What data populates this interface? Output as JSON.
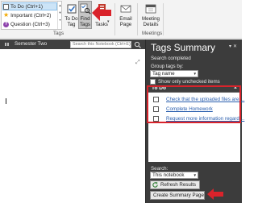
{
  "ribbon": {
    "tags": [
      {
        "label": "To Do (Ctrl+1)",
        "icon": "checkbox-icon"
      },
      {
        "label": "Important (Ctrl+2)",
        "icon": "star-icon"
      },
      {
        "label": "Question (Ctrl+3)",
        "icon": "question-icon"
      }
    ],
    "tags_group_label": "Tags",
    "todo_tag_line1": "To Do",
    "todo_tag_line2": "Tag",
    "find_tags_line1": "Find",
    "find_tags_line2": "Tags",
    "outlook_tasks_label": "Tasks",
    "email_page_line1": "Email",
    "email_page_line2": "Page",
    "meeting_details_line1": "Meeting",
    "meeting_details_line2": "Details",
    "meetings_group_label": "Meetings"
  },
  "notebook": {
    "section_name": "Semester Two",
    "search_placeholder": "Search this Notebook (Ctrl+E)"
  },
  "pane": {
    "title": "Tags Summary",
    "status": "Search completed",
    "group_by_label": "Group tags by:",
    "group_by_value": "Tag name",
    "show_unchecked_label": "Show only unchecked items",
    "results_header": "To Do",
    "results": [
      "Check that the uploaded files are ...",
      "Complete Homework",
      "Request more information regardi..."
    ],
    "search_label": "Search:",
    "search_scope": "This notebook",
    "refresh_label": "Refresh Results",
    "create_summary_label": "Create Summary Page"
  },
  "colors": {
    "annotation_red": "#d9232b",
    "pane_background": "#3c3c3c",
    "link_blue": "#2b5fae"
  }
}
